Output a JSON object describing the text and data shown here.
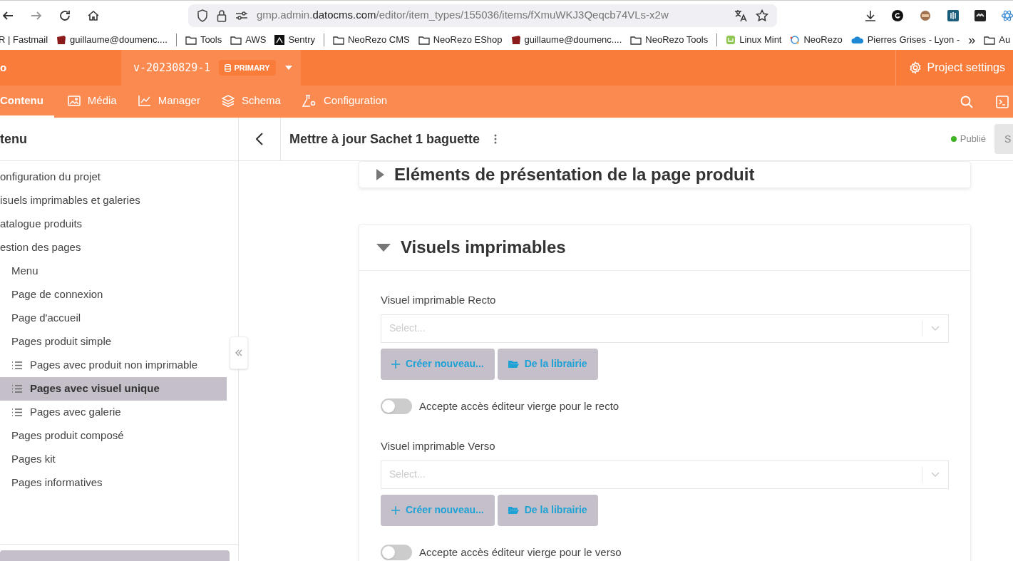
{
  "browser": {
    "url": {
      "subdomain": "gmp.admin.",
      "domain": "datocms.com",
      "path": "/editor/item_types/155036/items/fXmuWKJ3Qeqcb74VLs-x2w"
    },
    "bookmarks": [
      {
        "kind": "mail",
        "label": "R | Fastmail"
      },
      {
        "kind": "box",
        "label": "guillaume@doumenc...."
      },
      {
        "kind": "separator"
      },
      {
        "kind": "folder",
        "label": "Tools"
      },
      {
        "kind": "folder",
        "label": "AWS"
      },
      {
        "kind": "sentry",
        "label": "Sentry"
      },
      {
        "kind": "separator"
      },
      {
        "kind": "folder",
        "label": "NeoRezo CMS"
      },
      {
        "kind": "folder",
        "label": "NeoRezo EShop"
      },
      {
        "kind": "box",
        "label": "guillaume@doumenc...."
      },
      {
        "kind": "folder",
        "label": "NeoRezo Tools"
      },
      {
        "kind": "separator"
      },
      {
        "kind": "mint",
        "label": "Linux Mint"
      },
      {
        "kind": "rezo",
        "label": "NeoRezo"
      },
      {
        "kind": "cloud",
        "label": "Pierres Grises - Lyon -"
      },
      {
        "kind": "more",
        "label": "»"
      },
      {
        "kind": "folder",
        "label": "Au"
      }
    ]
  },
  "app": {
    "logo_text": "o",
    "environment": "v-20230829-1",
    "environment_badge": "PRIMARY",
    "project_settings": "Project settings",
    "tabs": [
      {
        "label": "Contenu",
        "selected": true
      },
      {
        "label": "Média",
        "selected": false
      },
      {
        "label": "Manager",
        "selected": false
      },
      {
        "label": "Schema",
        "selected": false
      },
      {
        "label": "Configuration",
        "selected": false
      }
    ]
  },
  "sidebar": {
    "title": "tenu",
    "items": [
      {
        "label": "onfiguration du projet",
        "selected": false
      },
      {
        "label": "isuels imprimables et galeries",
        "selected": false
      },
      {
        "label": "atalogue produits",
        "selected": false
      },
      {
        "label": "estion des pages",
        "selected": false,
        "children": [
          {
            "label": "Menu",
            "selected": false
          },
          {
            "label": "Page de connexion",
            "selected": false
          },
          {
            "label": "Page d'accueil",
            "selected": false
          },
          {
            "label": "Pages produit simple",
            "selected": false,
            "children": [
              {
                "label": "Pages avec produit non imprimable",
                "kind": "list",
                "selected": false
              },
              {
                "label": "Pages avec visuel unique",
                "kind": "list",
                "selected": true
              },
              {
                "label": "Pages avec galerie",
                "kind": "list",
                "selected": false
              }
            ]
          },
          {
            "label": "Pages produit composé",
            "selected": false
          },
          {
            "label": "Pages kit",
            "selected": false
          },
          {
            "label": "Pages informatives",
            "selected": false
          }
        ]
      }
    ]
  },
  "editor": {
    "title": "Mettre à jour Sachet 1 baguette",
    "status": "Publié",
    "action_button": "S",
    "sections": [
      {
        "title": "Eléments de présentation de la page produit",
        "expanded": false
      },
      {
        "title": "Visuels imprimables",
        "expanded": true,
        "fields": [
          {
            "kind": "select",
            "label": "Visuel imprimable Recto",
            "placeholder": "Select...",
            "buttons": [
              "Créer nouveau...",
              "De la librairie"
            ]
          },
          {
            "kind": "toggle",
            "label": "Accepte accès éditeur vierge pour le recto",
            "on": false
          },
          {
            "kind": "select",
            "label": "Visuel imprimable Verso",
            "placeholder": "Select...",
            "buttons": [
              "Créer nouveau...",
              "De la librairie"
            ]
          },
          {
            "kind": "toggle",
            "label": "Accepte accès éditeur vierge pour le verso",
            "on": false
          }
        ]
      }
    ]
  }
}
